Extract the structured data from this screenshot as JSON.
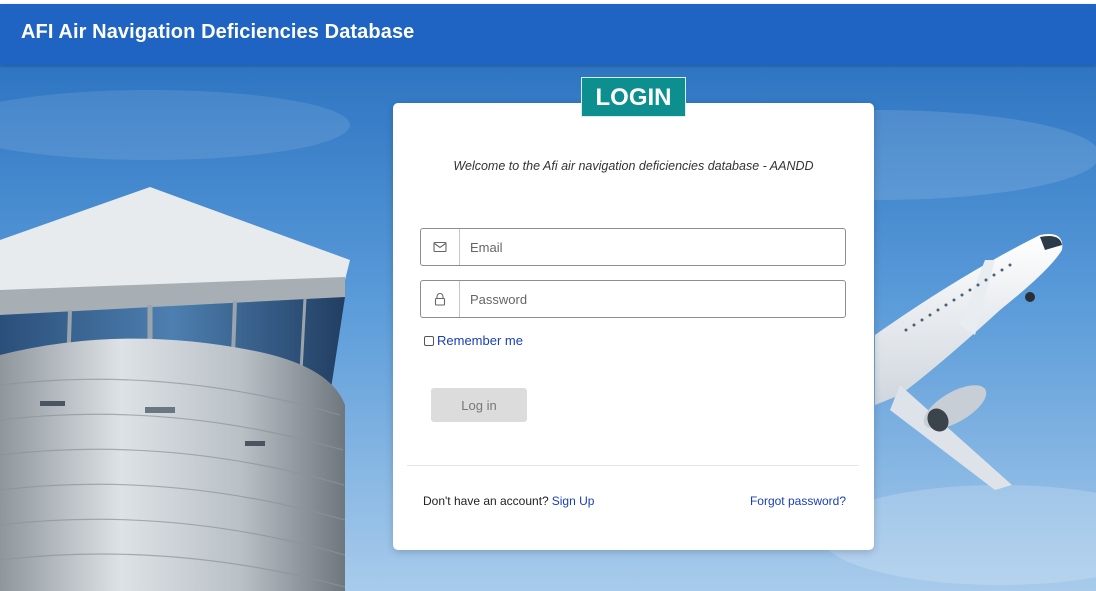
{
  "header": {
    "title": "AFI Air Navigation Deficiencies Database"
  },
  "login": {
    "badge": "LOGIN",
    "welcome": "Welcome to the Afi air navigation deficiencies database - AANDD",
    "email": {
      "placeholder": "Email",
      "value": "",
      "icon": "mail-icon"
    },
    "password": {
      "placeholder": "Password",
      "value": "",
      "icon": "lock-icon"
    },
    "remember_label": "Remember me",
    "remember_checked": false,
    "login_button": "Log in",
    "no_account_text": "Don't have an account?",
    "signup_link": "Sign Up",
    "forgot_link": "Forgot password?"
  },
  "colors": {
    "header_bg": "#1f64c3",
    "badge_bg": "#0e8f8f",
    "link": "#1a3eb8",
    "button_disabled_bg": "#dcdcdc"
  }
}
